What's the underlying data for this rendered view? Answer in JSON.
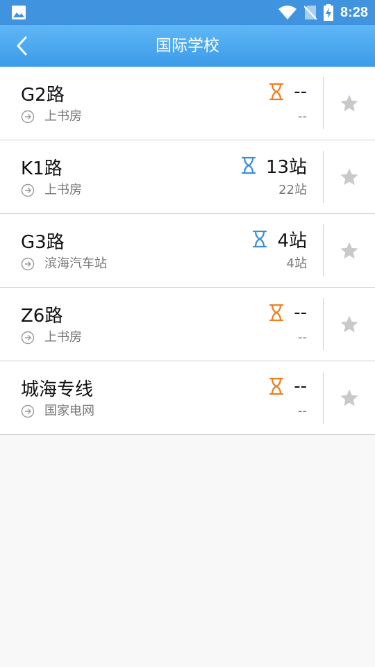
{
  "status_bar": {
    "time": "8:28",
    "icons": [
      "image-icon",
      "wifi-icon",
      "no-sim-icon",
      "battery-charging-icon"
    ]
  },
  "app_bar": {
    "title": "国际学校",
    "back_icon": "chevron-left-icon"
  },
  "colors": {
    "status_bar": "#3f93df",
    "app_bar": "#4aa8ef",
    "hourglass_orange": "#f07f1f",
    "hourglass_blue": "#3b8fd6",
    "star": "#c9c9c9"
  },
  "routes": [
    {
      "name": "G2路",
      "destination": "上书房",
      "eta": "--",
      "sub": "--",
      "status": "orange"
    },
    {
      "name": "K1路",
      "destination": "上书房",
      "eta": "13站",
      "sub": "22站",
      "status": "blue"
    },
    {
      "name": "G3路",
      "destination": "滨海汽车站",
      "eta": "4站",
      "sub": "4站",
      "status": "blue"
    },
    {
      "name": "Z6路",
      "destination": "上书房",
      "eta": "--",
      "sub": "--",
      "status": "orange"
    },
    {
      "name": "城海专线",
      "destination": "国家电网",
      "eta": "--",
      "sub": "--",
      "status": "orange"
    }
  ]
}
